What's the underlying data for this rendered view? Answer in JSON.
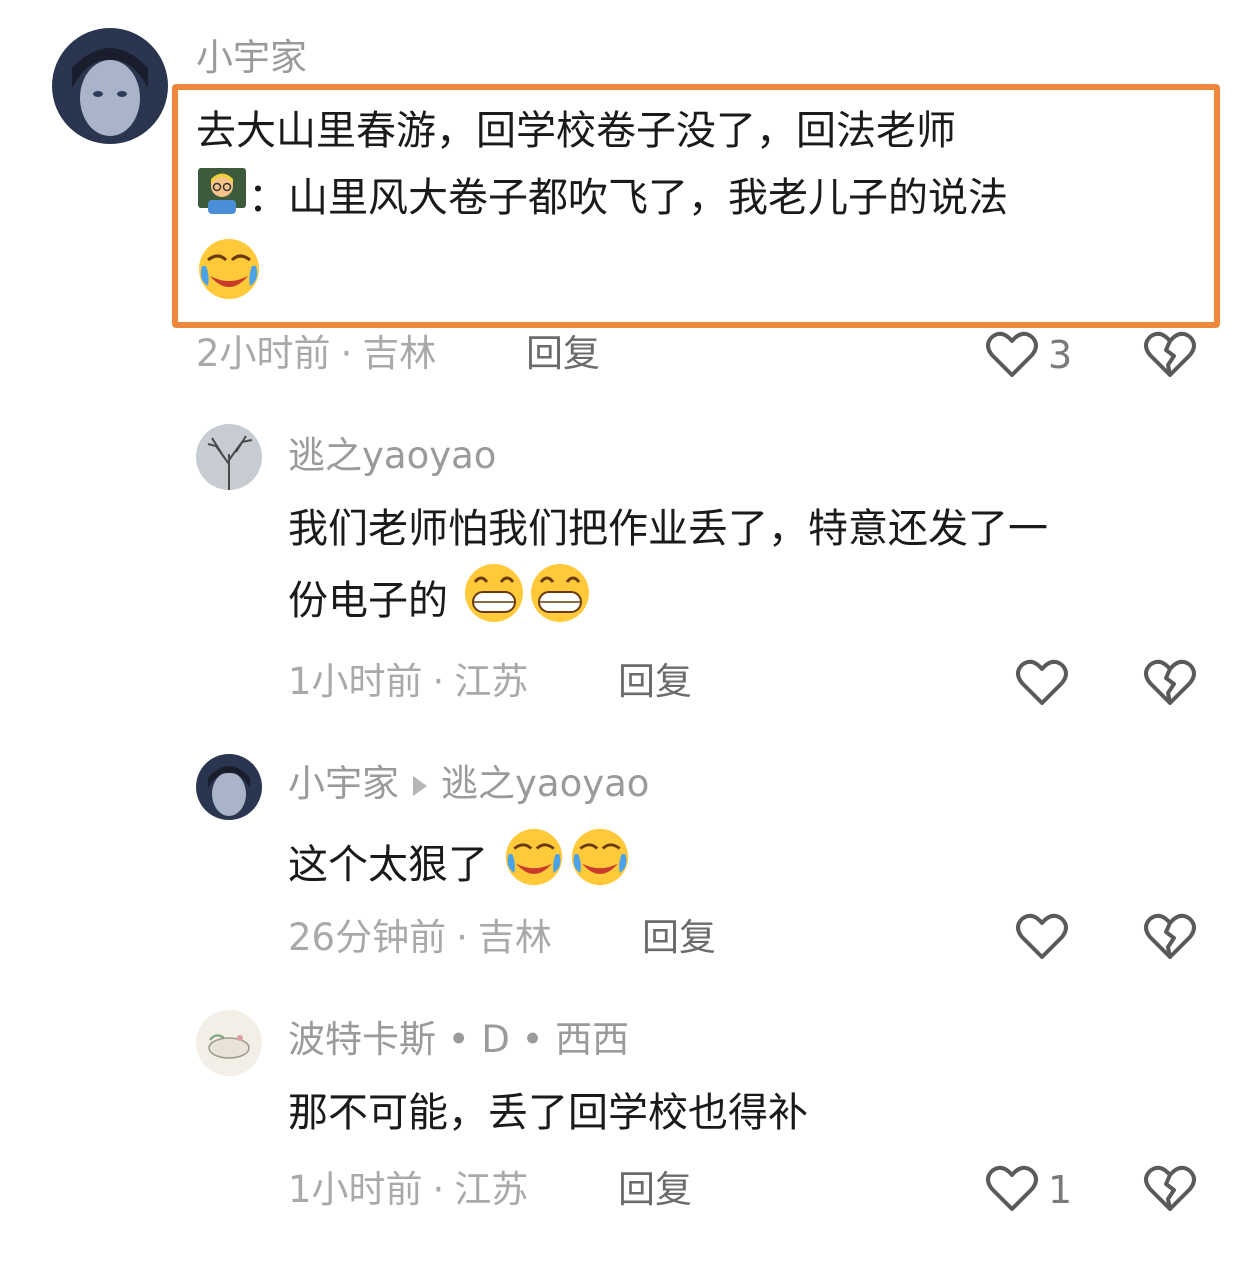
{
  "comments": [
    {
      "author": "小宇家",
      "text_line1": "去大山里春游，回学校卷子没了，回法老师",
      "text_line2": "：山里风大卷子都吹飞了，我老儿子的说法",
      "time": "2小时前",
      "location": "吉林",
      "reply_label": "回复",
      "likes": "3"
    },
    {
      "author": "逃之yaoyao",
      "text_line1": "我们老师怕我们把作业丢了，特意还发了一",
      "text_line2": "份电子的",
      "time": "1小时前",
      "location": "江苏",
      "reply_label": "回复"
    },
    {
      "author": "小宇家",
      "reply_to": "逃之yaoyao",
      "text_line1": "这个太狠了",
      "time": "26分钟前",
      "location": "吉林",
      "reply_label": "回复"
    },
    {
      "author": "波特卡斯 • D • 西西",
      "text_line1": "那不可能，丢了回学校也得补",
      "time": "1小时前",
      "location": "江苏",
      "reply_label": "回复",
      "likes": "1"
    }
  ],
  "separator": "·",
  "colors": {
    "highlight_border": "#f0883c"
  }
}
